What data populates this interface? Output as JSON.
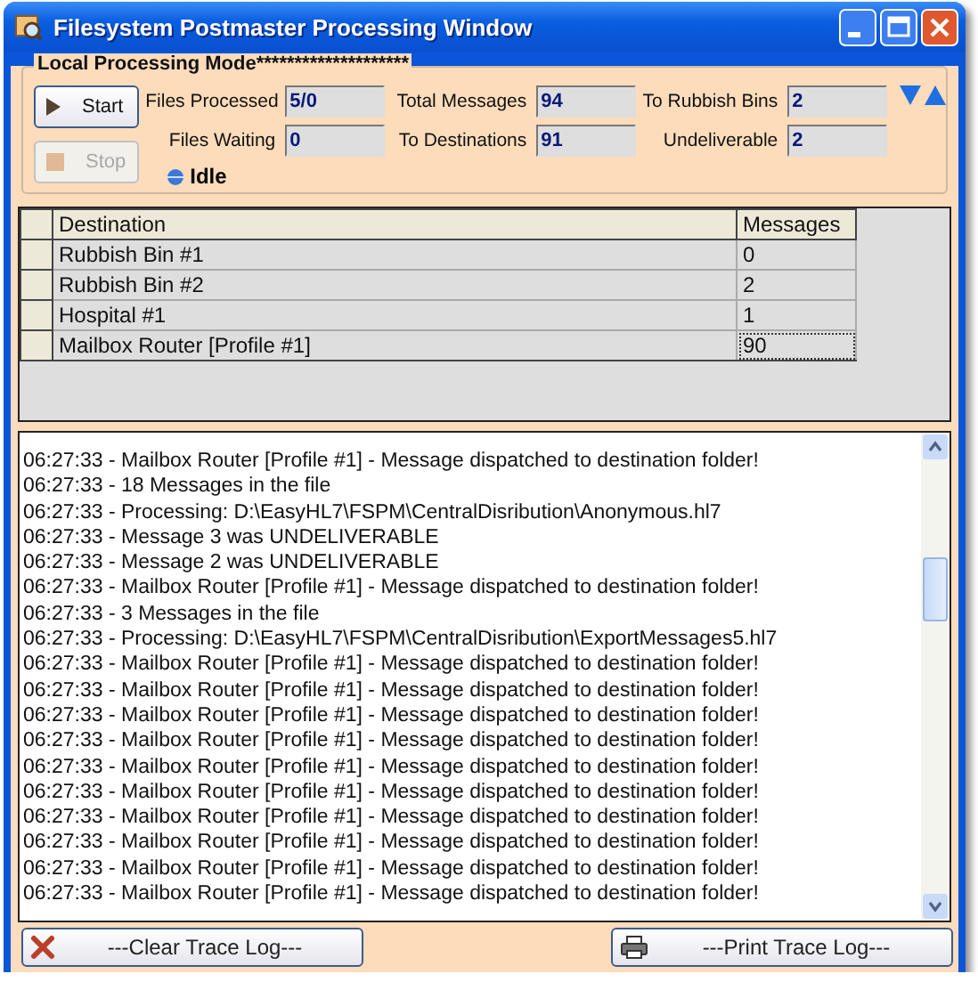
{
  "window": {
    "title": "Filesystem Postmaster Processing Window"
  },
  "mode_group": {
    "title": "Local Processing Mode********************"
  },
  "controls": [
    {
      "label": "Start",
      "kind": "start",
      "disabled": false
    },
    {
      "label": "Stop",
      "kind": "stop",
      "disabled": true
    }
  ],
  "stats": [
    {
      "label": "Files Processed",
      "value": "5/0"
    },
    {
      "label": "Files Waiting",
      "value": "0"
    },
    {
      "label": "Total Messages",
      "value": "94"
    },
    {
      "label": "To Destinations",
      "value": "91"
    },
    {
      "label": "To Rubbish Bins",
      "value": "2"
    },
    {
      "label": "Undeliverable",
      "value": "2"
    }
  ],
  "status": {
    "text": "Idle"
  },
  "table": {
    "columns": [
      "Destination",
      "Messages"
    ],
    "rows": [
      {
        "destination": "Rubbish Bin #1",
        "messages": "0",
        "focused": false
      },
      {
        "destination": "Rubbish Bin #2",
        "messages": "2",
        "focused": false
      },
      {
        "destination": "Hospital #1",
        "messages": "1",
        "focused": false
      },
      {
        "destination": "Mailbox Router [Profile #1]",
        "messages": "90",
        "focused": true
      }
    ]
  },
  "log": {
    "lines": [
      "06:27:33 - Mailbox Router [Profile #1] - Message dispatched to destination folder!",
      "06:27:33 - 18 Messages in the file",
      "06:27:33 - Processing: D:\\EasyHL7\\FSPM\\CentralDisribution\\Anonymous.hl7",
      "06:27:33 - Message 3 was UNDELIVERABLE",
      "06:27:33 - Message 2 was UNDELIVERABLE",
      "06:27:33 - Mailbox Router [Profile #1] - Message dispatched to destination folder!",
      "06:27:33 - 3 Messages in the file",
      "06:27:33 - Processing: D:\\EasyHL7\\FSPM\\CentralDisribution\\ExportMessages5.hl7",
      "06:27:33 - Mailbox Router [Profile #1] - Message dispatched to destination folder!",
      "06:27:33 - Mailbox Router [Profile #1] - Message dispatched to destination folder!",
      "06:27:33 - Mailbox Router [Profile #1] - Message dispatched to destination folder!",
      "06:27:33 - Mailbox Router [Profile #1] - Message dispatched to destination folder!",
      "06:27:33 - Mailbox Router [Profile #1] - Message dispatched to destination folder!",
      "06:27:33 - Mailbox Router [Profile #1] - Message dispatched to destination folder!",
      "06:27:33 - Mailbox Router [Profile #1] - Message dispatched to destination folder!",
      "06:27:33 - Mailbox Router [Profile #1] - Message dispatched to destination folder!",
      "06:27:33 - Mailbox Router [Profile #1] - Message dispatched to destination folder!",
      "06:27:33 - Mailbox Router [Profile #1] - Message dispatched to destination folder!"
    ]
  },
  "footer_buttons": [
    {
      "label": "---Clear Trace Log---",
      "kind": "clear"
    },
    {
      "label": "---Print Trace Log---",
      "kind": "print"
    }
  ]
}
